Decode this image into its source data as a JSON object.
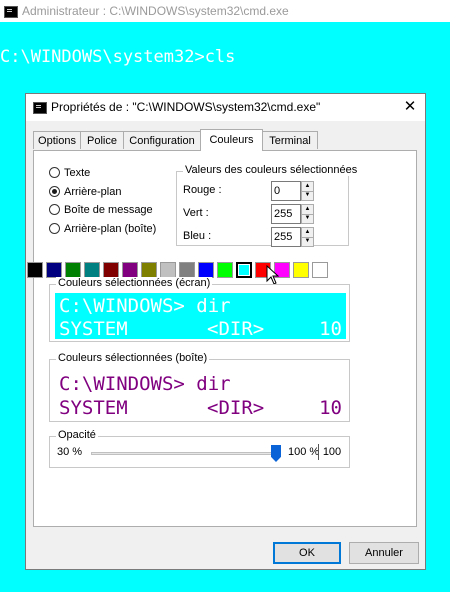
{
  "console": {
    "title": "Administrateur : C:\\WINDOWS\\system32\\cmd.exe",
    "prompt_line": "C:\\WINDOWS\\system32>cls"
  },
  "dialog": {
    "title": "Propriétés de : \"C:\\WINDOWS\\system32\\cmd.exe\"",
    "close": "✕",
    "tabs": [
      "Options",
      "Police",
      "Configuration",
      "Couleurs",
      "Terminal"
    ],
    "active_tab": "Couleurs",
    "radios": [
      {
        "label": "Texte",
        "selected": false
      },
      {
        "label": "Arrière-plan",
        "selected": true
      },
      {
        "label": "Boîte de message",
        "selected": false
      },
      {
        "label": "Arrière-plan (boîte)",
        "selected": false
      }
    ],
    "values_group": {
      "title": "Valeurs des couleurs sélectionnées",
      "red_label": "Rouge :",
      "red": "0",
      "green_label": "Vert :",
      "green": "255",
      "blue_label": "Bleu :",
      "blue": "255"
    },
    "palette": [
      "#000000",
      "#000080",
      "#008000",
      "#008080",
      "#800000",
      "#800080",
      "#808000",
      "#c0c0c0",
      "#808080",
      "#0000ff",
      "#00ff00",
      "#00ffff",
      "#ff0000",
      "#ff00ff",
      "#ffff00",
      "#ffffff"
    ],
    "selected_swatch_index": 11,
    "screen_preview": {
      "title": "Couleurs sélectionnées (écran)",
      "line1": "C:\\WINDOWS> dir",
      "line2_a": "SYSTEM",
      "line2_b": "<DIR>",
      "line2_c": "10",
      "bg": "#00ffff",
      "fg": "#ffffff"
    },
    "popup_preview": {
      "title": "Couleurs sélectionnées (boîte)",
      "line1": "C:\\WINDOWS> dir",
      "line2_a": "SYSTEM",
      "line2_b": "<DIR>",
      "line2_c": "10",
      "bg": "#ffffff",
      "fg": "#800080"
    },
    "opacity": {
      "title": "Opacité",
      "min_label": "30 %",
      "max_label": "100 %",
      "value": "100",
      "fraction": 1.0
    },
    "ok": "OK",
    "cancel": "Annuler"
  },
  "colors": {
    "accent": "#0078d7",
    "console_bg": "#00ffff"
  }
}
